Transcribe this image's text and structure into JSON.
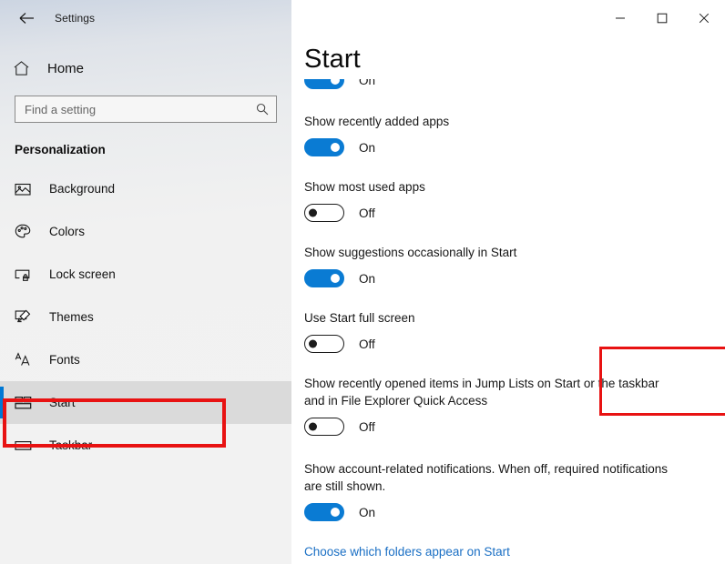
{
  "window": {
    "app_title": "Settings",
    "back_icon": "back-arrow-icon",
    "controls": {
      "minimize": "minimize-icon",
      "maximize": "maximize-icon",
      "close": "close-icon"
    }
  },
  "sidebar": {
    "home": {
      "label": "Home",
      "icon": "home-icon"
    },
    "search": {
      "placeholder": "Find a setting",
      "value": "",
      "icon": "search-icon"
    },
    "section_title": "Personalization",
    "items": [
      {
        "label": "Background",
        "icon": "picture-icon",
        "selected": false
      },
      {
        "label": "Colors",
        "icon": "palette-icon",
        "selected": false
      },
      {
        "label": "Lock screen",
        "icon": "lock-screen-icon",
        "selected": false
      },
      {
        "label": "Themes",
        "icon": "brush-icon",
        "selected": false
      },
      {
        "label": "Fonts",
        "icon": "fonts-icon",
        "selected": false
      },
      {
        "label": "Start",
        "icon": "start-tiles-icon",
        "selected": true
      },
      {
        "label": "Taskbar",
        "icon": "taskbar-icon",
        "selected": false
      }
    ]
  },
  "main": {
    "page_title": "Start",
    "settings": [
      {
        "label": "",
        "state": "On",
        "toggle": "on",
        "clipped": true
      },
      {
        "label": "Show recently added apps",
        "state": "On",
        "toggle": "on"
      },
      {
        "label": "Show most used apps",
        "state": "Off",
        "toggle": "off"
      },
      {
        "label": "Show suggestions occasionally in Start",
        "state": "On",
        "toggle": "on"
      },
      {
        "label": "Use Start full screen",
        "state": "Off",
        "toggle": "off"
      },
      {
        "label": "Show recently opened items in Jump Lists on Start or the taskbar and in File Explorer Quick Access",
        "state": "Off",
        "toggle": "off",
        "highlighted": true
      },
      {
        "label": "Show account-related notifications. When off, required notifications are still shown.",
        "state": "On",
        "toggle": "on"
      }
    ],
    "link": "Choose which folders appear on Start"
  },
  "annotations": {
    "highlight_color": "#e81212",
    "accent_color": "#0078d4"
  }
}
